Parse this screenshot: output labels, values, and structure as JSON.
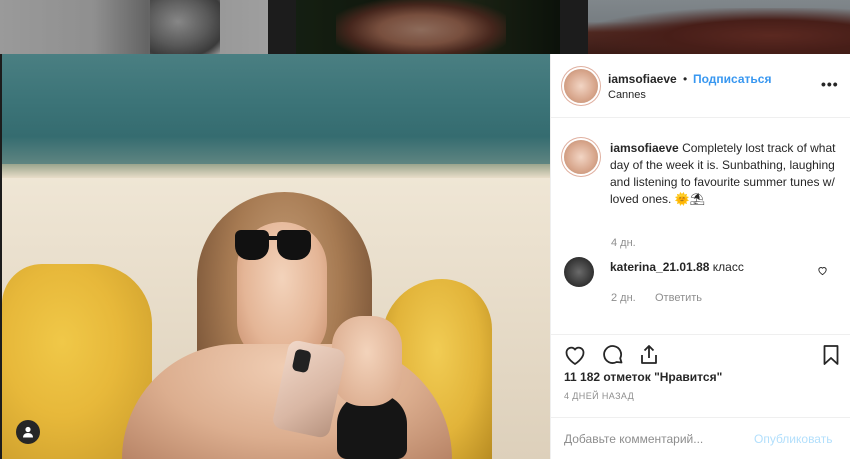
{
  "post": {
    "username": "iamsofiaeve",
    "follow_label": "Подписаться",
    "separator": "•",
    "location": "Cannes",
    "more_label": "•••",
    "caption_text": "Completely lost track of what day of the week it is. Sunbathing, laughing and listening to favourite summer tunes w/ loved ones. 🌞⛱",
    "caption_time": "4 дн.",
    "comments": [
      {
        "username": "katerina_21.01.88",
        "text": "класс",
        "time": "2 дн.",
        "reply_label": "Ответить"
      }
    ],
    "likes_text": "11 182 отметок \"Нравится\"",
    "date_text": "4 ДНЕЙ НАЗАД",
    "comment_placeholder": "Добавьте комментарий...",
    "post_button": "Опубликовать"
  },
  "icons": {
    "like": "heart-icon",
    "comment": "speech-bubble-icon",
    "share": "share-icon",
    "save": "bookmark-icon",
    "tag": "user-tag-icon"
  },
  "colors": {
    "accent": "#3897f0",
    "post_button_disabled": "#b2dffc",
    "muted": "#8e8e8e",
    "text": "#262626"
  }
}
